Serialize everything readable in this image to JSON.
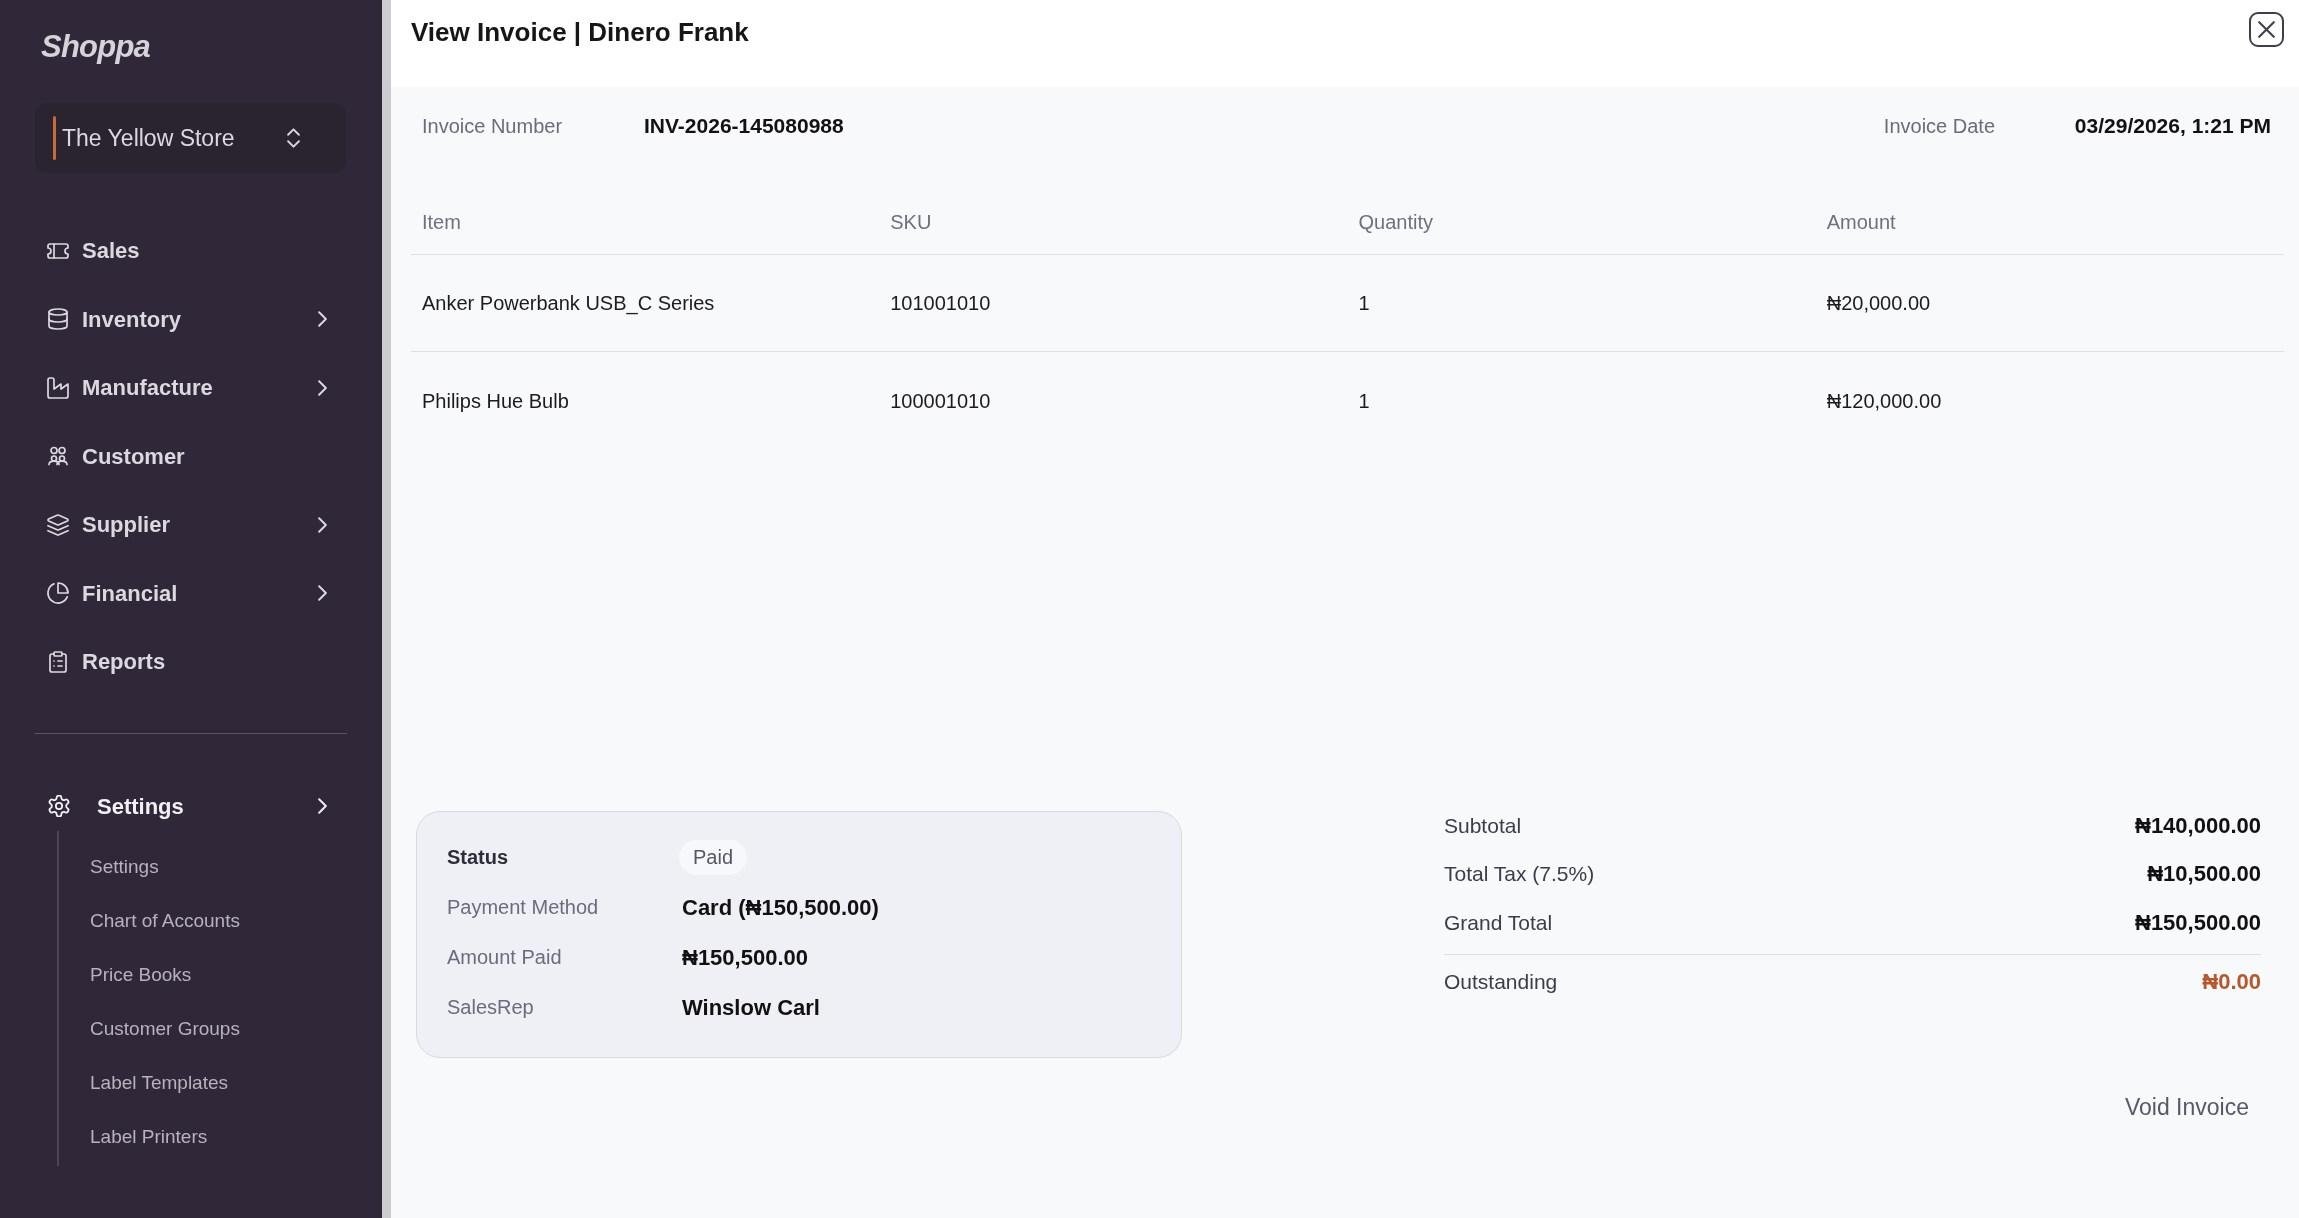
{
  "sidebar": {
    "logo": "Shoppa",
    "store_selector": {
      "label": "The Yellow Store"
    },
    "nav_items": [
      {
        "label": "Sales",
        "has_submenu": false
      },
      {
        "label": "Inventory",
        "has_submenu": true
      },
      {
        "label": "Manufacture",
        "has_submenu": true
      },
      {
        "label": "Customer",
        "has_submenu": false
      },
      {
        "label": "Supplier",
        "has_submenu": true
      },
      {
        "label": "Financial",
        "has_submenu": true
      },
      {
        "label": "Reports",
        "has_submenu": false
      }
    ],
    "settings": {
      "label": "Settings",
      "has_submenu": true,
      "expanded": true,
      "children": [
        {
          "label": "Settings"
        },
        {
          "label": "Chart of Accounts"
        },
        {
          "label": "Price Books"
        },
        {
          "label": "Customer Groups"
        },
        {
          "label": "Label Templates"
        },
        {
          "label": "Label Printers"
        }
      ]
    }
  },
  "dialog": {
    "title": "View Invoice | Dinero Frank",
    "invoice_number": {
      "label": "Invoice Number",
      "value": "INV-2026-145080988"
    },
    "invoice_date": {
      "label": "Invoice Date",
      "value": "03/29/2026, 1:21 PM"
    },
    "table": {
      "columns": [
        "Item",
        "SKU",
        "Quantity",
        "Amount"
      ],
      "rows": [
        [
          "Anker Powerbank USB_C Series",
          "101001010",
          "1",
          "₦20,000.00"
        ],
        [
          "Philips Hue Bulb",
          "100001010",
          "1",
          "₦120,000.00"
        ]
      ]
    },
    "payment": [
      {
        "kind": "badge",
        "label": "Status",
        "value": "Paid"
      },
      {
        "kind": "text",
        "label": "Payment Method",
        "value": "Card (₦150,500.00)"
      },
      {
        "kind": "text",
        "label": "Amount Paid",
        "value": "₦150,500.00"
      },
      {
        "kind": "text",
        "label": "SalesRep",
        "value": "Winslow Carl"
      }
    ],
    "totals": [
      {
        "kind": "line",
        "label": "Subtotal",
        "value": "₦140,000.00"
      },
      {
        "kind": "line",
        "label": "Total Tax (7.5%)",
        "value": "₦10,500.00"
      },
      {
        "kind": "line",
        "label": "Grand Total",
        "value": "₦150,500.00"
      },
      {
        "kind": "balance",
        "label": "Outstanding",
        "value": "₦0.00"
      }
    ],
    "actions": [
      {
        "label": "Void Invoice"
      }
    ]
  }
}
